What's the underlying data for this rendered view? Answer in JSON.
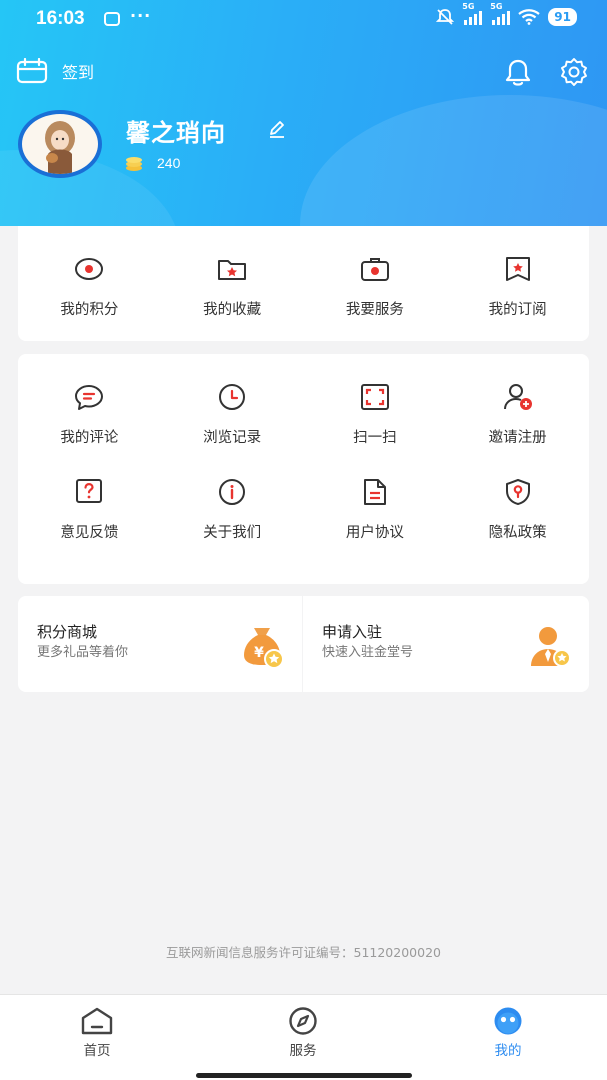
{
  "status_bar": {
    "time": "16:03",
    "dots": "···",
    "signal1_tag": "5G",
    "signal2_tag": "5G",
    "battery": "91"
  },
  "header": {
    "checkin_label": "签到",
    "username": "馨之琑向",
    "points": "240"
  },
  "quick_actions": [
    {
      "label": "我的积分",
      "icon": "points-icon"
    },
    {
      "label": "我的收藏",
      "icon": "favorites-folder-icon"
    },
    {
      "label": "我要服务",
      "icon": "service-bag-icon"
    },
    {
      "label": "我的订阅",
      "icon": "subscription-bookmark-icon"
    }
  ],
  "tools": [
    {
      "label": "我的评论",
      "icon": "comment-icon"
    },
    {
      "label": "浏览记录",
      "icon": "history-clock-icon"
    },
    {
      "label": "扫一扫",
      "icon": "scan-icon"
    },
    {
      "label": "邀请注册",
      "icon": "invite-user-icon"
    },
    {
      "label": "意见反馈",
      "icon": "feedback-question-icon"
    },
    {
      "label": "关于我们",
      "icon": "info-icon"
    },
    {
      "label": "用户协议",
      "icon": "agreement-document-icon"
    },
    {
      "label": "隐私政策",
      "icon": "privacy-shield-icon"
    }
  ],
  "promos": {
    "mall_title": "积分商城",
    "mall_subtitle": "更多礼品等着你",
    "apply_title": "申请入驻",
    "apply_subtitle": "快速入驻金堂号"
  },
  "license_text": "互联网新闻信息服务许可证编号：51120200020",
  "tabbar": [
    {
      "label": "首页",
      "icon": "home-icon",
      "active": false
    },
    {
      "label": "服务",
      "icon": "compass-icon",
      "active": false
    },
    {
      "label": "我的",
      "icon": "profile-face-icon",
      "active": true
    }
  ],
  "colors": {
    "header_start": "#25c6f6",
    "header_end": "#2f96f3",
    "accent_red": "#e8342f",
    "active_tab": "#2d8cf0"
  }
}
